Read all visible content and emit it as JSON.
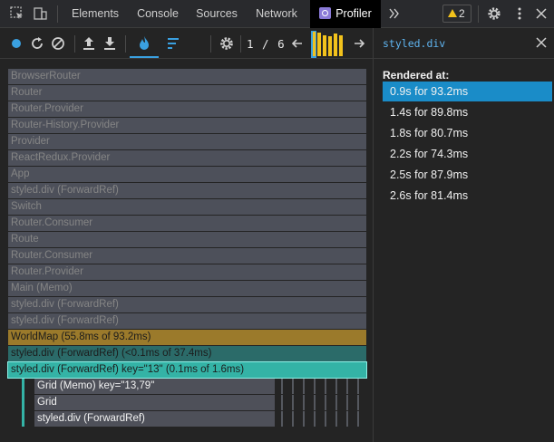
{
  "devtools_tabs": [
    {
      "label": "Elements",
      "active": false
    },
    {
      "label": "Console",
      "active": false
    },
    {
      "label": "Sources",
      "active": false
    },
    {
      "label": "Network",
      "active": false
    },
    {
      "label": "Profiler",
      "active": true
    }
  ],
  "warning_count": "2",
  "toolbar": {
    "commit_index": "1 / 6",
    "commit_bars": [
      1,
      0.98,
      0.86,
      0.8,
      0.94,
      0.87
    ]
  },
  "flame_rows": [
    {
      "label": "BrowserRouter",
      "style": "gray"
    },
    {
      "label": "Router",
      "style": "gray"
    },
    {
      "label": "Router.Provider",
      "style": "gray"
    },
    {
      "label": "Router-History.Provider",
      "style": "gray"
    },
    {
      "label": "Provider",
      "style": "gray"
    },
    {
      "label": "ReactRedux.Provider",
      "style": "gray"
    },
    {
      "label": "App",
      "style": "gray"
    },
    {
      "label": "styled.div (ForwardRef)",
      "style": "gray"
    },
    {
      "label": "Switch",
      "style": "gray"
    },
    {
      "label": "Router.Consumer",
      "style": "gray"
    },
    {
      "label": "Route",
      "style": "gray"
    },
    {
      "label": "Router.Consumer",
      "style": "gray"
    },
    {
      "label": "Router.Provider",
      "style": "gray"
    },
    {
      "label": "Main (Memo)",
      "style": "gray"
    },
    {
      "label": "styled.div (ForwardRef)",
      "style": "gray"
    },
    {
      "label": "styled.div (ForwardRef)",
      "style": "gray"
    },
    {
      "label": "WorldMap (55.8ms of 93.2ms)",
      "style": "gold"
    },
    {
      "label": "styled.div (ForwardRef) (<0.1ms of 37.4ms)",
      "style": "teal"
    },
    {
      "label": "styled.div (ForwardRef) key=\"13\" (0.1ms of 1.6ms)",
      "style": "cyan"
    }
  ],
  "child_rows": [
    {
      "label": "Grid (Memo) key=\"13,79\""
    },
    {
      "label": "Grid"
    },
    {
      "label": "styled.div (ForwardRef)"
    }
  ],
  "side_panel": {
    "title": "styled.div",
    "rendered_label": "Rendered at:",
    "items": [
      "0.9s for 93.2ms",
      "1.4s for 89.8ms",
      "1.8s for 80.7ms",
      "2.2s for 74.3ms",
      "2.5s for 87.9ms",
      "2.6s for 81.4ms"
    ],
    "selected_index": 0
  },
  "colors": {
    "accent": "#1a8cc8",
    "commit_bar": "#f2c21c",
    "side_title": "#5fb4ef",
    "highlight_teal": "#34b3a6",
    "worldmap_gold": "#9b7a2b"
  }
}
